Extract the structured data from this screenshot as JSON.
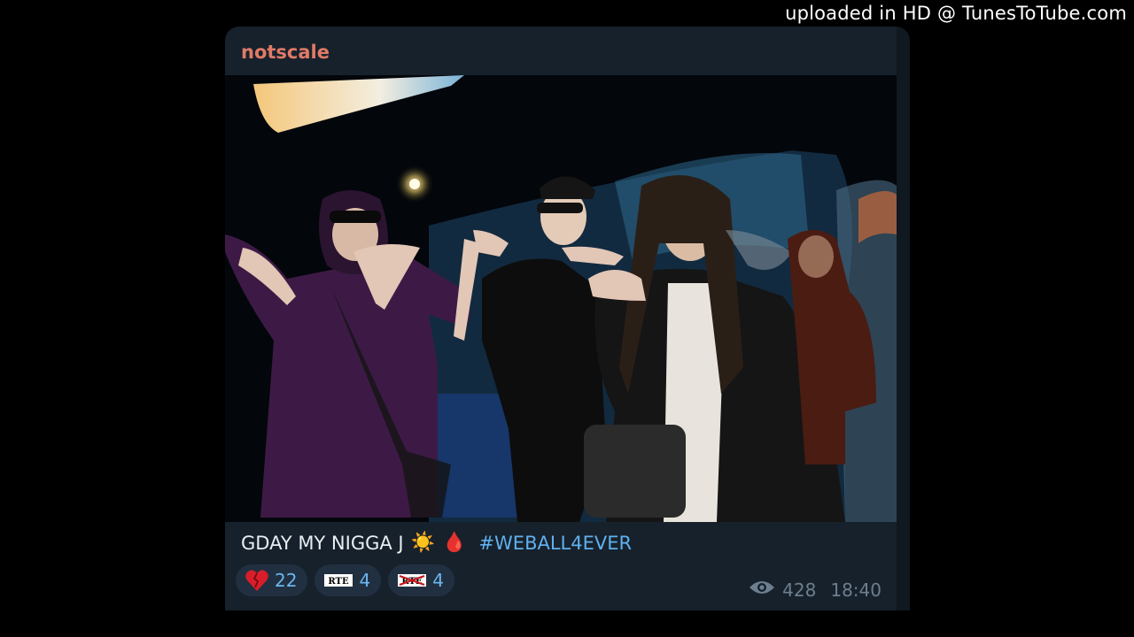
{
  "watermark": "uploaded in HD @ TunesToTube.com",
  "post": {
    "channel_name": "notscale",
    "caption": {
      "text": "GDAY MY NIGGA J",
      "emojis": [
        "☀️",
        "🩸"
      ],
      "hashtag": "#WEBALL4EVER"
    },
    "reactions": [
      {
        "icon": "broken-heart-icon",
        "count": "22"
      },
      {
        "icon": "rte-sticker-icon",
        "label": "RTE",
        "count": "4"
      },
      {
        "icon": "rte-crossed-sticker-icon",
        "label": "RTE",
        "count": "4"
      }
    ],
    "views": "428",
    "time": "18:40"
  },
  "colors": {
    "background": "#000000",
    "card": "#17212b",
    "channel_name": "#e07a67",
    "link": "#5fb0ee",
    "reaction_bg": "#213040",
    "meta": "#6d7f8f"
  }
}
